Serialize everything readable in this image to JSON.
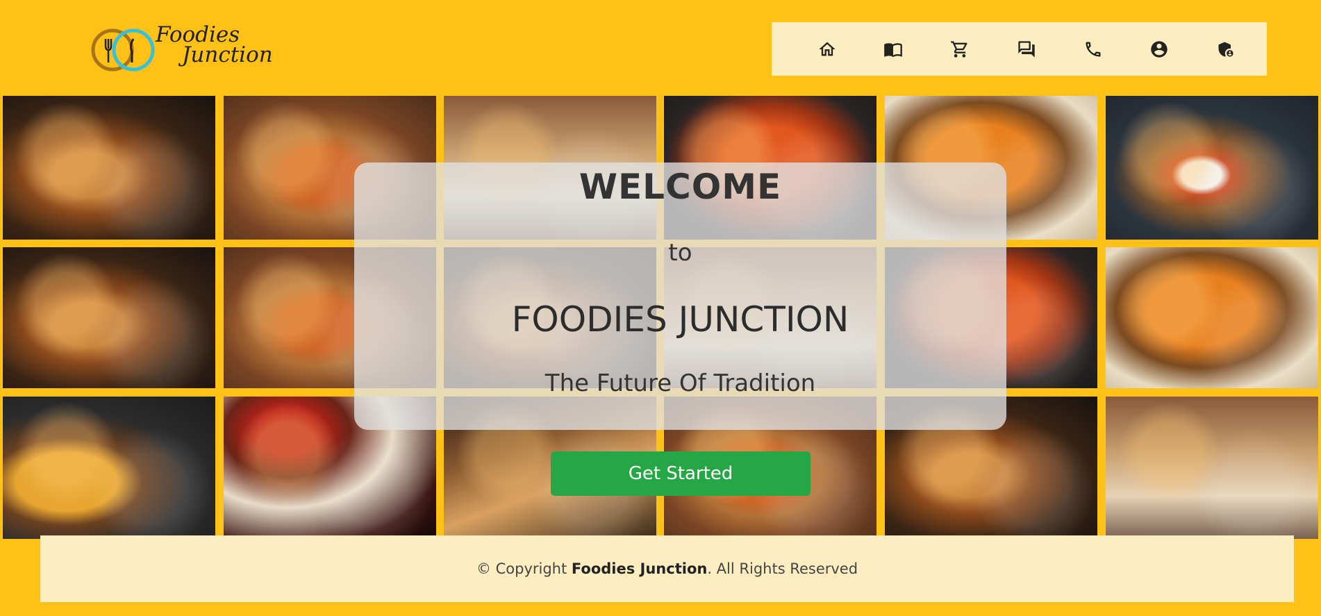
{
  "brand": {
    "logo_line1": "Foodies",
    "logo_line2": "Junction"
  },
  "nav": {
    "items": [
      {
        "icon": "home-icon"
      },
      {
        "icon": "menu-book-icon"
      },
      {
        "icon": "cart-icon"
      },
      {
        "icon": "chat-icon"
      },
      {
        "icon": "phone-icon"
      },
      {
        "icon": "account-icon"
      },
      {
        "icon": "admin-shield-icon"
      }
    ]
  },
  "welcome": {
    "title": "WELCOME",
    "to": "to",
    "name": "FOODIES JUNCTION",
    "tagline": "The Future Of Tradition",
    "cta_label": "Get Started"
  },
  "footer": {
    "prefix": "© Copyright ",
    "brand": "Foodies Junction",
    "suffix": ". All Rights Reserved"
  },
  "gallery": {
    "rows": [
      [
        "spread",
        "curry-rice",
        "restaurant-interior",
        "egg-curry",
        "butter-chicken",
        "rice-plate"
      ],
      [
        "spread",
        "curry-rice",
        "spread",
        "restaurant-interior",
        "egg-curry",
        "butter-chicken"
      ],
      [
        "paratha-chutney",
        "dining-table",
        "restaurant-interior",
        "curry-rice",
        "spread",
        "restaurant-lounge"
      ]
    ]
  },
  "colors": {
    "background": "#ffc116",
    "panel": "#fdeec2",
    "cta": "#25a745"
  }
}
